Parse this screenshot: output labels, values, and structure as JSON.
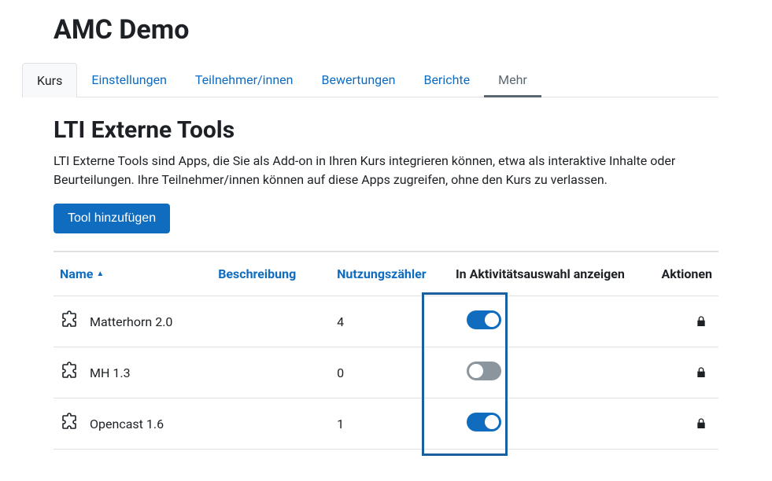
{
  "course": {
    "title": "AMC Demo"
  },
  "tabs": [
    {
      "label": "Kurs",
      "active": true
    },
    {
      "label": "Einstellungen"
    },
    {
      "label": "Teilnehmer/innen"
    },
    {
      "label": "Bewertungen"
    },
    {
      "label": "Berichte"
    },
    {
      "label": "Mehr",
      "more": true
    }
  ],
  "section": {
    "title": "LTI Externe Tools",
    "description": "LTI Externe Tools sind Apps, die Sie als Add-on in Ihren Kurs integrieren können, etwa als interaktive Inhalte oder Beurteilungen. Ihre Teilnehmer/innen können auf diese Apps zugreifen, ohne den Kurs zu verlassen."
  },
  "buttons": {
    "add_tool": "Tool hinzufügen"
  },
  "columns": {
    "name": "Name",
    "description": "Beschreibung",
    "usage": "Nutzungszähler",
    "show": "In Aktivitätsauswahl anzeigen",
    "actions": "Aktionen"
  },
  "tools": [
    {
      "name": "Matterhorn 2.0",
      "description": "",
      "usage": "4",
      "show": true,
      "locked": true
    },
    {
      "name": "MH 1.3",
      "description": "",
      "usage": "0",
      "show": false,
      "locked": true
    },
    {
      "name": "Opencast 1.6",
      "description": "",
      "usage": "1",
      "show": true,
      "locked": true
    }
  ],
  "colors": {
    "primary": "#0f6cbf"
  }
}
